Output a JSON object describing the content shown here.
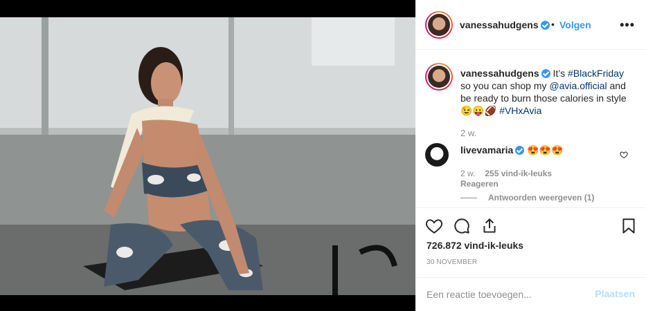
{
  "post": {
    "username": "vanessahudgens",
    "dot": "•",
    "follow_label": "Volgen",
    "more_label": "•••"
  },
  "caption": {
    "username": "vanessahudgens",
    "text_before_tag": " It’s ",
    "hashtag_1": "#BlackFriday",
    "text_mid": " so you can shop my ",
    "mention": "@avia.official",
    "text_after": " and be ready to burn those calories in style ",
    "emojis": "😉😛🏈",
    "hashtag_2": "#VHxAvia",
    "time": "2 w."
  },
  "comment": {
    "username": "livevamaria",
    "text": "😍😍😍",
    "time": "2 w.",
    "likes": "255 vind-ik-leuks",
    "reply_label": "Reageren",
    "view_replies": "Antwoorden weergeven (1)"
  },
  "actions": {
    "likes_count": "726.872 vind-ik-leuks",
    "date": "30 NOVEMBER"
  },
  "add_comment": {
    "placeholder": "Een reactie toevoegen...",
    "post_label": "Plaatsen"
  },
  "colors": {
    "accent": "#3897f0",
    "link": "#003569",
    "muted": "#8e8e8e",
    "post_disabled": "#b2dffc"
  }
}
